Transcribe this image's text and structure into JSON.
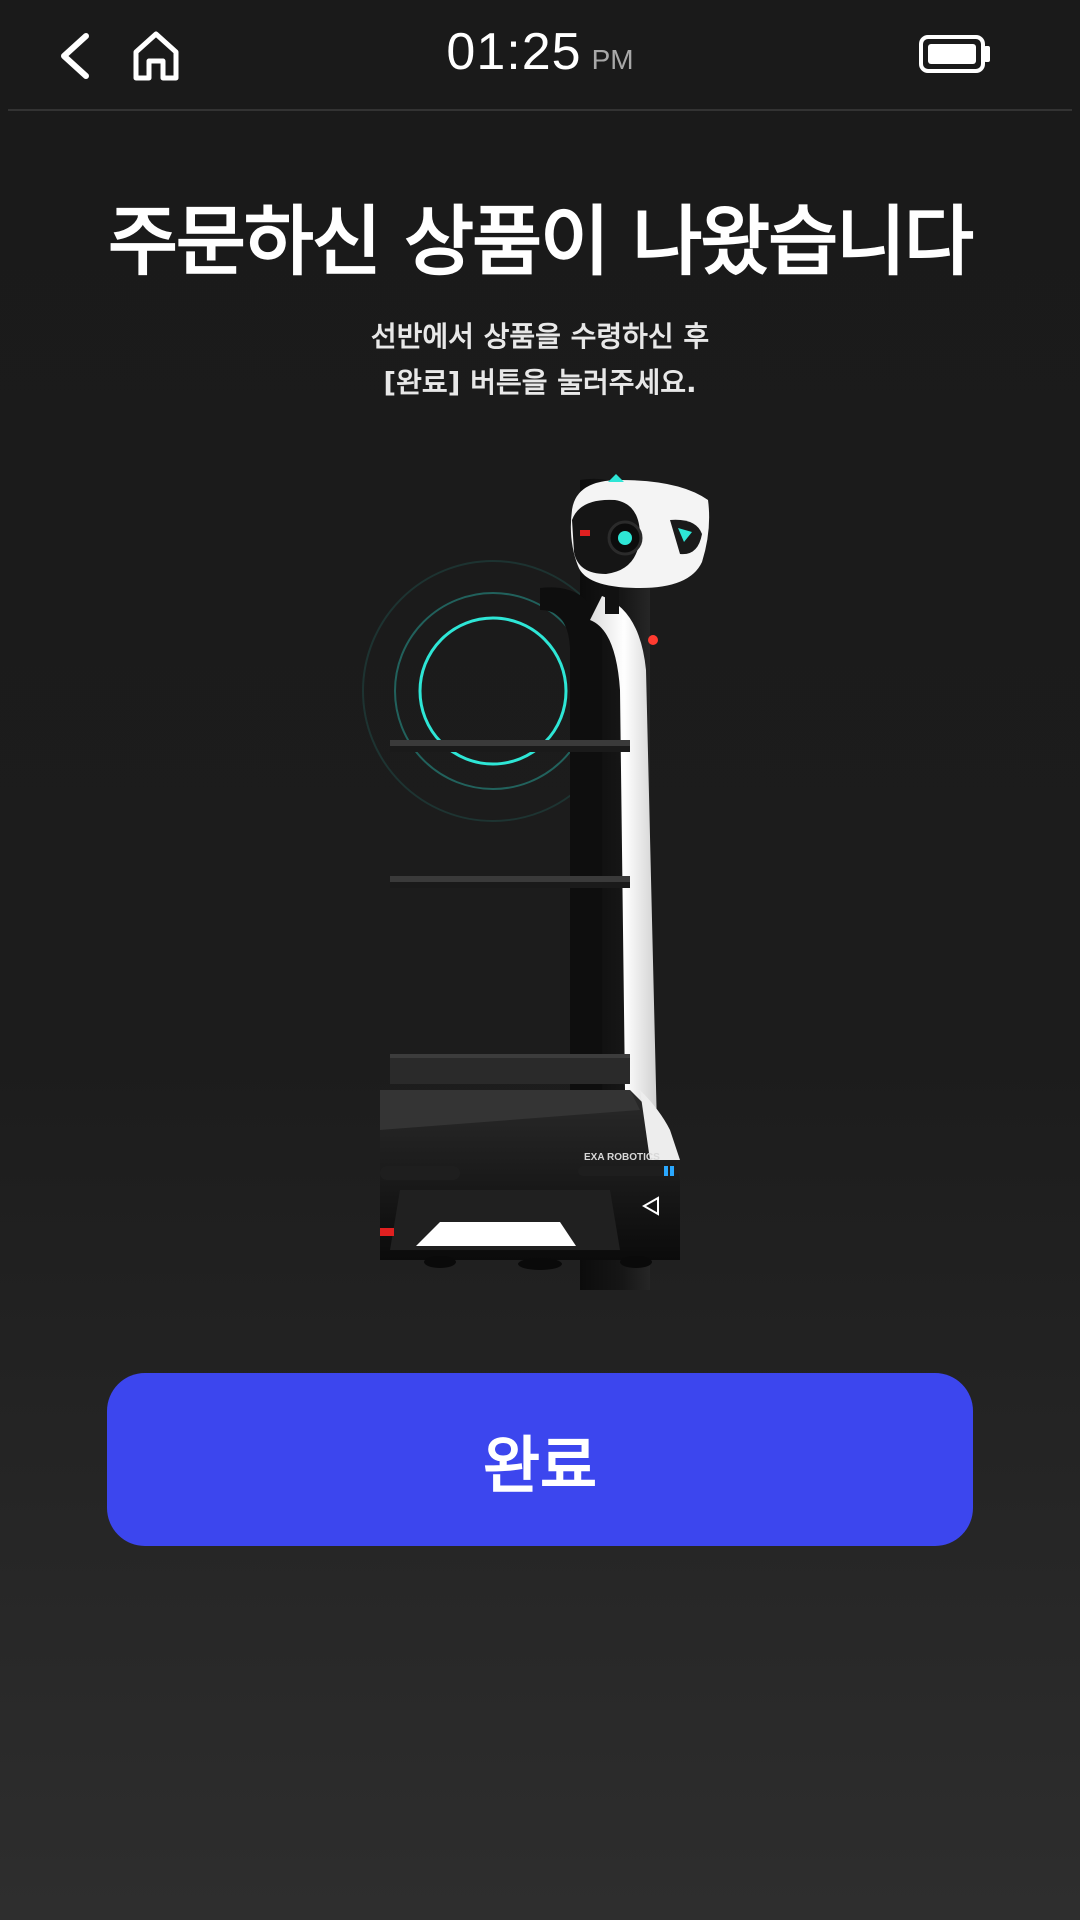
{
  "status_bar": {
    "time": "01:25",
    "ampm": "PM",
    "battery_icon": "battery-full-icon",
    "back_icon": "chevron-left-icon",
    "home_icon": "home-icon"
  },
  "message": {
    "title": "주문하신 상품이 나왔습니다",
    "subtitle_line1": "선반에서 상품을 수령하신 후",
    "subtitle_line2": "[완료] 버튼을 눌러주세요."
  },
  "robot": {
    "brand_label": "EXA ROBOTICS"
  },
  "actions": {
    "done_label": "완료"
  },
  "colors": {
    "background": "#1b1b1b",
    "primary_button": "#3c46ee",
    "accent_teal": "#2ee6d6",
    "text_primary": "#ffffff",
    "text_secondary": "#a8a8a8"
  }
}
